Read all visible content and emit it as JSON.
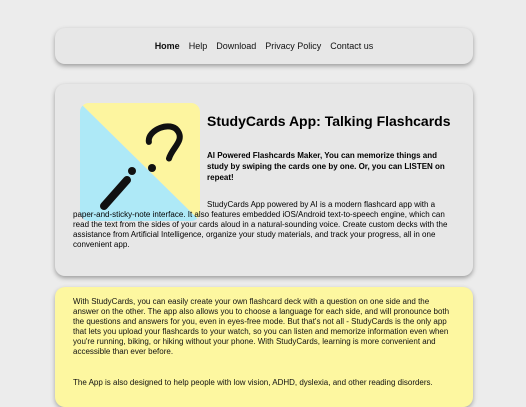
{
  "nav": {
    "items": [
      {
        "label": "Home",
        "active": true
      },
      {
        "label": "Help"
      },
      {
        "label": "Download"
      },
      {
        "label": "Privacy Policy"
      },
      {
        "label": "Contact us"
      }
    ]
  },
  "hero": {
    "title": "StudyCards App: Talking Flashcards",
    "subtitle": "AI Powered Flashcards Maker, You can memorize things and study by swiping the cards one by one. Or, you can LISTEN on repeat!",
    "description": "StudyCards App powered by AI is a modern flashcard app with a paper-and-sticky-note interface. It also features embedded iOS/Android text-to-speech engine, which can read the text from the sides of your cards aloud in a natural-sounding voice. Create custom decks with the assistance from Artificial Intelligence, organize your study materials, and track your progress, all in one convenient app.",
    "logo": {
      "icon": "question-exclamation-icon",
      "colors": {
        "yellow": "#fdf59f",
        "blue": "#aee9f7",
        "ink": "#111111"
      }
    }
  },
  "info": {
    "paragraph1": "With StudyCards, you can easily create your own flashcard deck with a question on one side and the answer on the other. The app also allows you to choose a language for each side, and will pronounce both the questions and answers for you, even in eyes-free mode. But that's not all - StudyCards is the only app that lets you upload your flashcards to your watch, so you can listen and memorize information even when you're running, biking, or hiking without your phone. With StudyCards, learning is more convenient and accessible than ever before.",
    "paragraph2": "The App is also designed to help people with low vision, ADHD, dyslexia, and other reading disorders."
  },
  "colors": {
    "page_bg": "#ececec",
    "card_bg": "#e7e7e7",
    "info_bg": "#fdf7a0"
  }
}
